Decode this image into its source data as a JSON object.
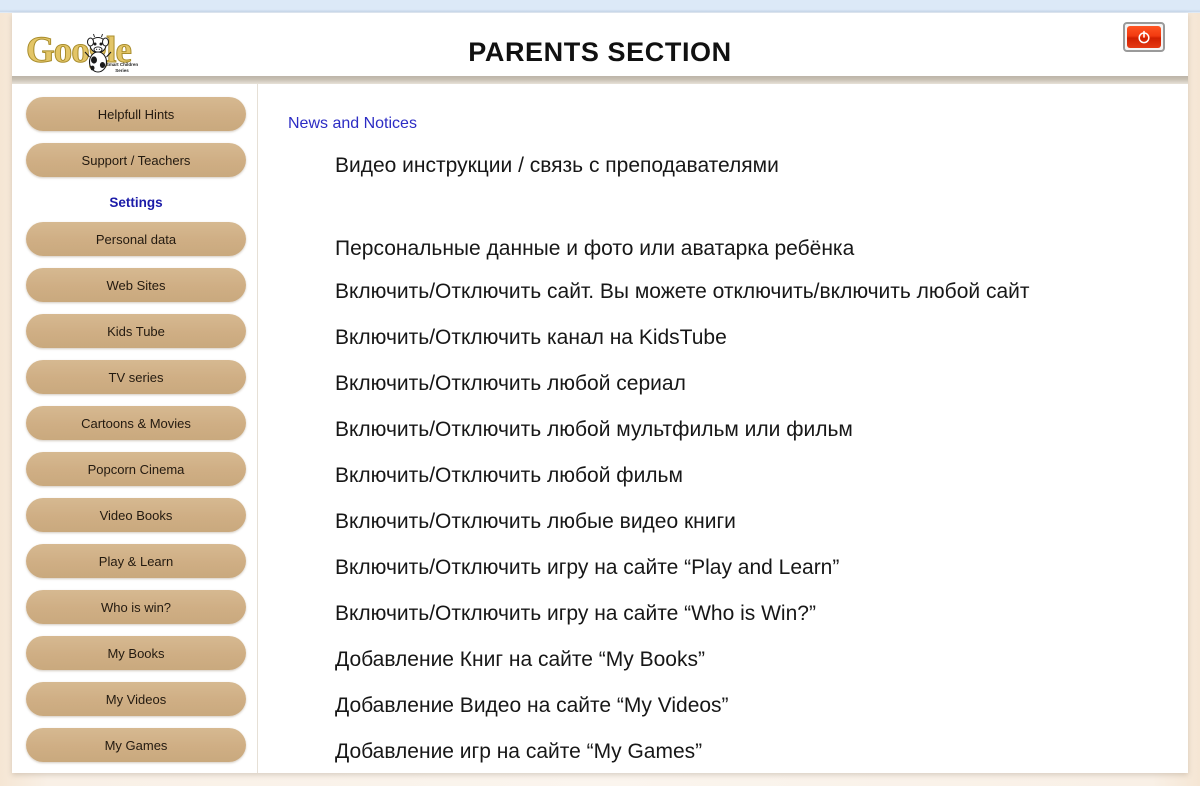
{
  "window": {
    "title": "PARENTS SECTION"
  },
  "logo": {
    "word": "Google",
    "subtitle_line1": "Smart Children",
    "subtitle_line2": "Series",
    "mascot": "cow-mascot-icon"
  },
  "header": {
    "exit_button_icon": "power-icon",
    "exit_button_label": ""
  },
  "sidebar": {
    "items": [
      {
        "label": "Helpfull Hints",
        "type": "button",
        "name": "helpfull-hints"
      },
      {
        "label": "Support / Teachers",
        "type": "button",
        "name": "support-teachers"
      },
      {
        "label": "Settings",
        "type": "heading",
        "name": "settings"
      },
      {
        "label": "Personal data",
        "type": "button",
        "name": "personal-data"
      },
      {
        "label": "Web Sites",
        "type": "button",
        "name": "web-sites"
      },
      {
        "label": "Kids Tube",
        "type": "button",
        "name": "kids-tube"
      },
      {
        "label": "TV series",
        "type": "button",
        "name": "tv-series"
      },
      {
        "label": "Cartoons & Movies",
        "type": "button",
        "name": "cartoons-movies"
      },
      {
        "label": "Popcorn Cinema",
        "type": "button",
        "name": "popcorn-cinema"
      },
      {
        "label": "Video Books",
        "type": "button",
        "name": "video-books"
      },
      {
        "label": "Play & Learn",
        "type": "button",
        "name": "play-learn"
      },
      {
        "label": "Who is win?",
        "type": "button",
        "name": "who-is-win"
      },
      {
        "label": "My Books",
        "type": "button",
        "name": "my-books"
      },
      {
        "label": "My Videos",
        "type": "button",
        "name": "my-videos"
      },
      {
        "label": "My Games",
        "type": "button",
        "name": "my-games"
      }
    ]
  },
  "main": {
    "section_label": "News and Notices",
    "rows": [
      "Видео инструкции / связь с преподавателями",
      "Персональные данные и фото или аватарка ребёнка",
      "Включить/Отключить сайт. Вы можете отключить/включить любой сайт",
      "Включить/Отключить канал на KidsTube",
      "Включить/Отключить любой сериал",
      "Включить/Отключить любой мультфильм или фильм",
      "Включить/Отключить любой фильм",
      "Включить/Отключить любые видео книги",
      "Включить/Отключить игру на сайте “Play and Learn”",
      "Включить/Отключить игру на сайте “Who is Win?”",
      "Добавление Книг на сайте “My Books”",
      "Добавление Видео на сайте “My Videos”",
      "Добавление игр на сайте “My Games”"
    ]
  },
  "colors": {
    "button_fill": "#cfae84",
    "accent_blue": "#1b1ba8",
    "news_blue": "#2c2cc4",
    "exit_red": "#e63a14",
    "page_background": "#f7ece0",
    "top_strip": "#dce9f7"
  }
}
